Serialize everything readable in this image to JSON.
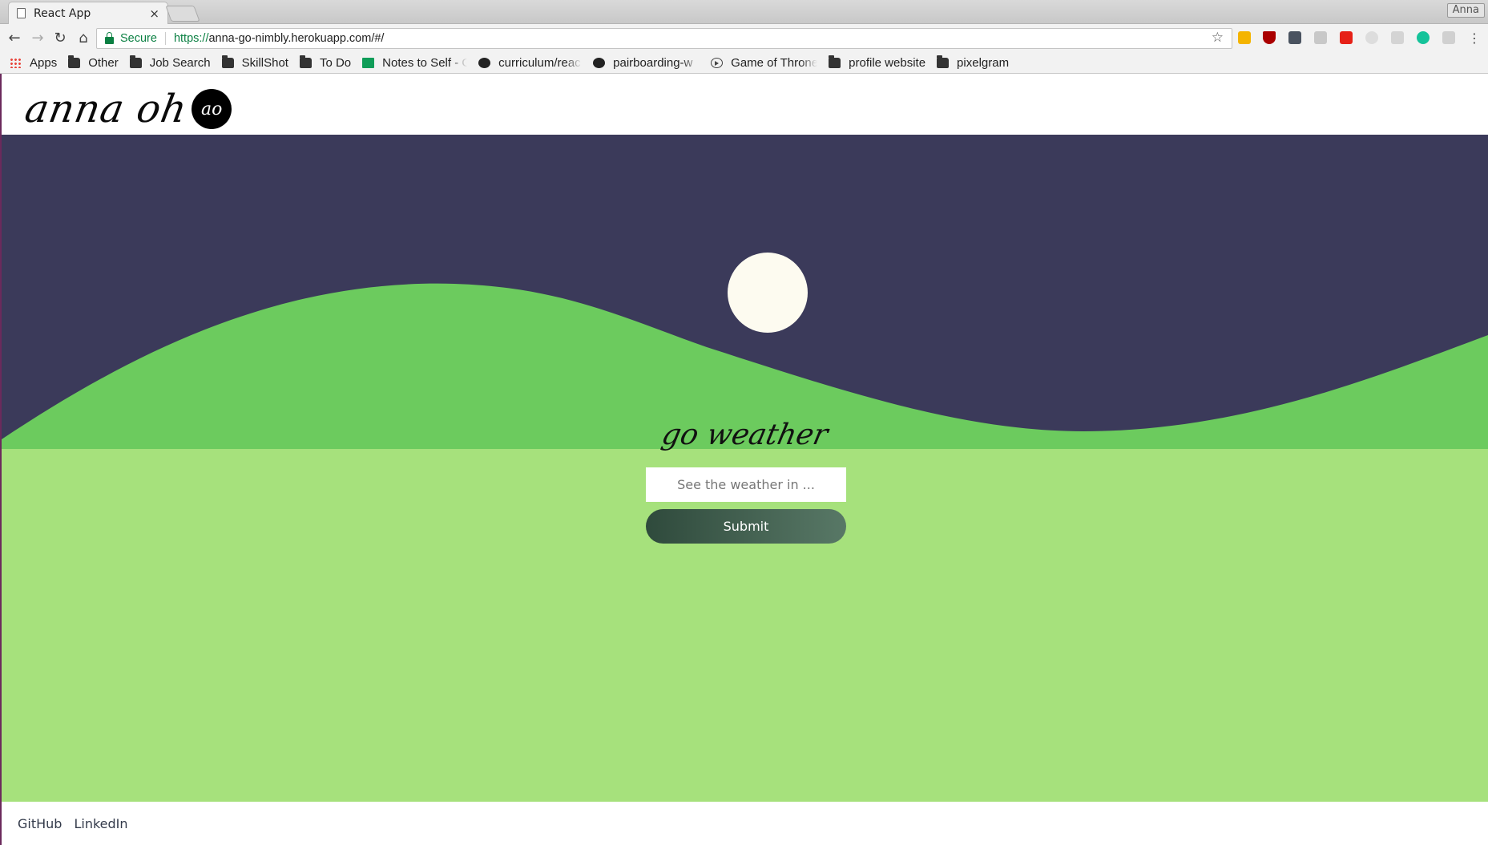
{
  "browser": {
    "tab_title": "React App",
    "tab_close": "×",
    "profile_name": "Anna",
    "secure_label": "Secure",
    "url_scheme": "https://",
    "url_rest": "anna-go-nimbly.herokuapp.com/#/",
    "bookmarks": [
      {
        "label": "Apps",
        "icon": "apps-grid-icon"
      },
      {
        "label": "Other",
        "icon": "folder-icon"
      },
      {
        "label": "Job Search",
        "icon": "folder-icon"
      },
      {
        "label": "SkillShot",
        "icon": "folder-icon"
      },
      {
        "label": "To Do",
        "icon": "folder-icon"
      },
      {
        "label": "Notes to Self - G",
        "icon": "sheets-icon"
      },
      {
        "label": "curriculum/reac",
        "icon": "github-icon"
      },
      {
        "label": "pairboarding-w",
        "icon": "github-icon"
      },
      {
        "label": "Game of Throne",
        "icon": "play-circle-icon"
      },
      {
        "label": "profile website",
        "icon": "folder-icon"
      },
      {
        "label": "pixelgram",
        "icon": "folder-icon"
      }
    ]
  },
  "header": {
    "logo_text": "anna oh",
    "logo_mark": "ao"
  },
  "hero": {
    "title": "go weather",
    "search_placeholder": "See the weather in ...",
    "submit_label": "Submit",
    "colors": {
      "sky": "#3b3a5a",
      "hill": "#6ccb5e",
      "ground": "#a6e17c",
      "moon": "#fdfbf0",
      "button_start": "#2f4a3c",
      "button_end": "#587866"
    }
  },
  "footer": {
    "links": [
      "GitHub",
      "LinkedIn"
    ]
  }
}
